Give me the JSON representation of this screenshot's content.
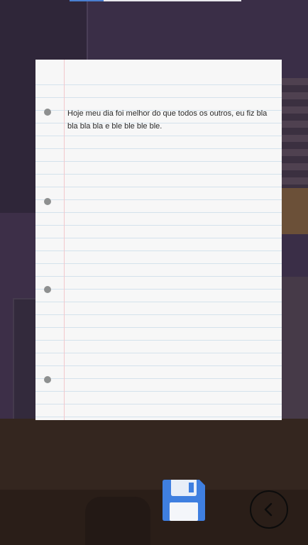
{
  "diary": {
    "entry_text": "Hoje meu dia foi melhor do que todos os outros, eu fiz bla bla bla bla e ble ble ble ble."
  },
  "toolbar": {
    "save_icon": "floppy-disk-icon",
    "back_icon": "chevron-left-icon"
  },
  "colors": {
    "paper": "#f7f7f7",
    "paper_line": "#d4e2ec",
    "margin_line": "#f2c8cc",
    "hole": "#8e9090",
    "save_accent": "#3f7fe0"
  }
}
